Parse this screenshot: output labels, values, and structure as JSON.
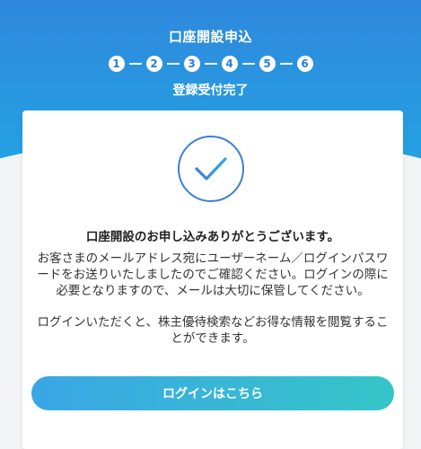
{
  "header": {
    "title": "口座開設申込",
    "steps": [
      "1",
      "2",
      "3",
      "4",
      "5",
      "6"
    ],
    "subtitle": "登録受付完了"
  },
  "card": {
    "title": "口座開設のお申し込みありがとうございます。",
    "message_1": "お客さまのメールアドレス宛にユーザーネーム／ログインパスワードをお送りいたしましたのでご確認ください。ログインの際に必要となりますので、メールは大切に保管してください。",
    "message_2": "ログインいただくと、株主優待検索などお得な情報を閲覧することができます。",
    "login_button": "ログインはこちら"
  },
  "colors": {
    "header_gradient_top": "#2f88dd",
    "header_gradient_bottom": "#21a7e3",
    "button_gradient_start": "#3aa6e6",
    "button_gradient_end": "#35c5c7",
    "check_color": "#3d7fd6"
  }
}
